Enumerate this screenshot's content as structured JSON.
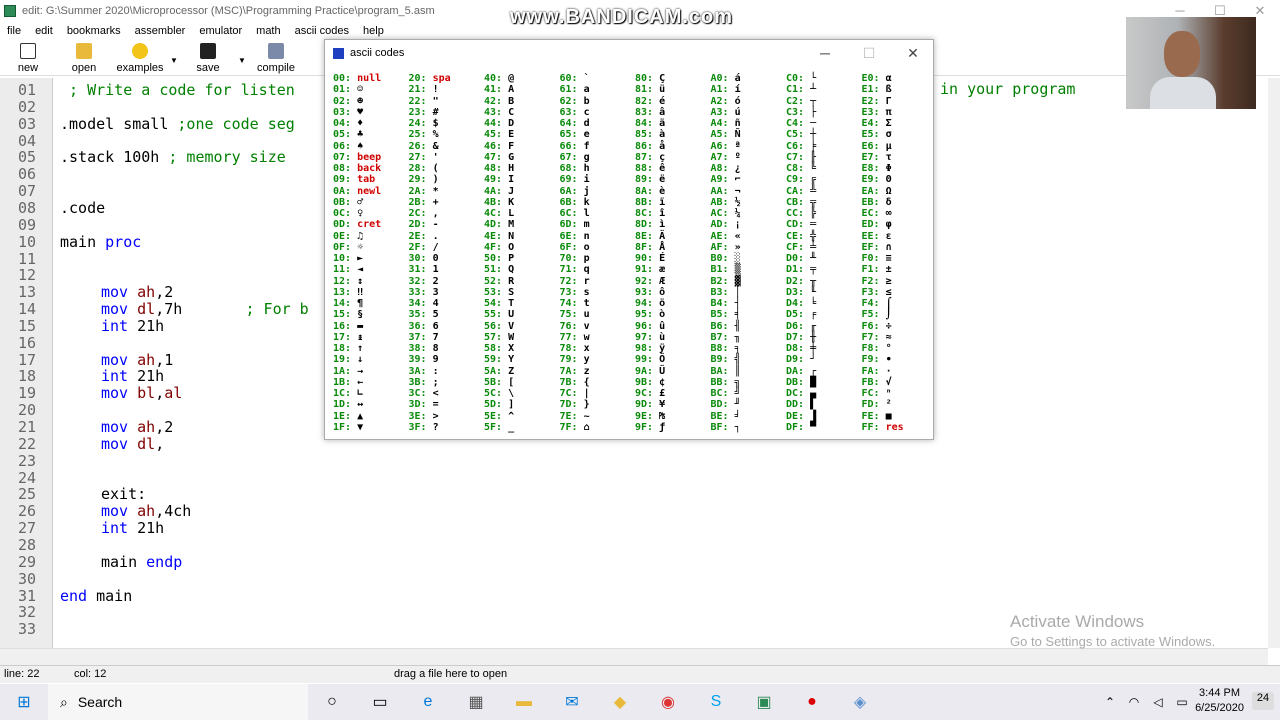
{
  "window": {
    "title": "edit: G:\\Summer 2020\\Microprocessor (MSC)\\Programming Practice\\program_5.asm"
  },
  "menu": [
    "file",
    "edit",
    "bookmarks",
    "assembler",
    "emulator",
    "math",
    "ascii codes",
    "help"
  ],
  "toolbar": [
    {
      "label": "new",
      "icon": "new-file-icon"
    },
    {
      "label": "open",
      "icon": "folder-icon"
    },
    {
      "label": "examples",
      "icon": "star-icon"
    },
    {
      "label": "save",
      "icon": "disk-icon"
    },
    {
      "label": "compile",
      "icon": "compile-icon"
    }
  ],
  "watermark": "www.BANDICAM.com",
  "line_numbers": [
    "01",
    "02",
    "03",
    "04",
    "05",
    "06",
    "07",
    "08",
    "09",
    "10",
    "11",
    "12",
    "13",
    "14",
    "15",
    "16",
    "17",
    "18",
    "19",
    "20",
    "21",
    "22",
    "23",
    "24",
    "25",
    "26",
    "27",
    "28",
    "29",
    "30",
    "31",
    "32",
    "33"
  ],
  "code": [
    {
      "line": 1,
      "indent": 0,
      "parts": [
        {
          "t": " ; Write a code for listen",
          "c": "cm"
        }
      ]
    },
    {
      "line": 3,
      "indent": 0,
      "parts": [
        {
          "t": ".model small ",
          "c": "pl"
        },
        {
          "t": ";one code seg",
          "c": "cm"
        }
      ]
    },
    {
      "line": 5,
      "indent": 0,
      "parts": [
        {
          "t": ".stack 100h ",
          "c": "pl"
        },
        {
          "t": "; memory size",
          "c": "cm"
        }
      ]
    },
    {
      "line": 8,
      "indent": 0,
      "parts": [
        {
          "t": ".code",
          "c": "pl"
        }
      ]
    },
    {
      "line": 10,
      "indent": 0,
      "parts": [
        {
          "t": "main ",
          "c": "pl"
        },
        {
          "t": "proc",
          "c": "kw"
        }
      ]
    },
    {
      "line": 13,
      "indent": 1,
      "parts": [
        {
          "t": "mov ",
          "c": "kw"
        },
        {
          "t": "ah",
          "c": "rg"
        },
        {
          "t": ",2",
          "c": "pl"
        }
      ]
    },
    {
      "line": 14,
      "indent": 1,
      "parts": [
        {
          "t": "mov ",
          "c": "kw"
        },
        {
          "t": "dl",
          "c": "rg"
        },
        {
          "t": ",7h       ",
          "c": "pl"
        },
        {
          "t": "; For b",
          "c": "cm"
        }
      ]
    },
    {
      "line": 15,
      "indent": 1,
      "parts": [
        {
          "t": "int ",
          "c": "kw"
        },
        {
          "t": "21h",
          "c": "pl"
        }
      ]
    },
    {
      "line": 17,
      "indent": 1,
      "parts": [
        {
          "t": "mov ",
          "c": "kw"
        },
        {
          "t": "ah",
          "c": "rg"
        },
        {
          "t": ",1",
          "c": "pl"
        }
      ]
    },
    {
      "line": 18,
      "indent": 1,
      "parts": [
        {
          "t": "int ",
          "c": "kw"
        },
        {
          "t": "21h",
          "c": "pl"
        }
      ]
    },
    {
      "line": 19,
      "indent": 1,
      "parts": [
        {
          "t": "mov ",
          "c": "kw"
        },
        {
          "t": "bl",
          "c": "rg"
        },
        {
          "t": ",",
          "c": "pl"
        },
        {
          "t": "al",
          "c": "rg"
        }
      ]
    },
    {
      "line": 21,
      "indent": 1,
      "parts": [
        {
          "t": "mov ",
          "c": "kw"
        },
        {
          "t": "ah",
          "c": "rg"
        },
        {
          "t": ",2",
          "c": "pl"
        }
      ]
    },
    {
      "line": 22,
      "indent": 1,
      "parts": [
        {
          "t": "mov ",
          "c": "kw"
        },
        {
          "t": "dl",
          "c": "rg"
        },
        {
          "t": ",",
          "c": "pl"
        }
      ]
    },
    {
      "line": 25,
      "indent": 1,
      "parts": [
        {
          "t": "exit:",
          "c": "pl"
        }
      ]
    },
    {
      "line": 26,
      "indent": 1,
      "parts": [
        {
          "t": "mov ",
          "c": "kw"
        },
        {
          "t": "ah",
          "c": "rg"
        },
        {
          "t": ",4ch",
          "c": "pl"
        }
      ]
    },
    {
      "line": 27,
      "indent": 1,
      "parts": [
        {
          "t": "int ",
          "c": "kw"
        },
        {
          "t": "21h",
          "c": "pl"
        }
      ]
    },
    {
      "line": 29,
      "indent": 1,
      "parts": [
        {
          "t": "main ",
          "c": "pl"
        },
        {
          "t": "endp",
          "c": "kw"
        }
      ]
    },
    {
      "line": 31,
      "indent": 0,
      "parts": [
        {
          "t": "end ",
          "c": "kw"
        },
        {
          "t": "main",
          "c": "pl"
        }
      ]
    }
  ],
  "code_right_fragment": "in your program",
  "ascii_dialog": {
    "title": "ascii codes",
    "columns": [
      [
        [
          "00",
          "null"
        ],
        [
          "01",
          "☺"
        ],
        [
          "02",
          "☻"
        ],
        [
          "03",
          "♥"
        ],
        [
          "04",
          "♦"
        ],
        [
          "05",
          "♣"
        ],
        [
          "06",
          "♠"
        ],
        [
          "07",
          "beep"
        ],
        [
          "08",
          "back"
        ],
        [
          "09",
          "tab"
        ],
        [
          "0A",
          "newl"
        ],
        [
          "0B",
          "♂"
        ],
        [
          "0C",
          "♀"
        ],
        [
          "0D",
          "cret"
        ],
        [
          "0E",
          "♫"
        ],
        [
          "0F",
          "☼"
        ],
        [
          "10",
          "►"
        ],
        [
          "11",
          "◄"
        ],
        [
          "12",
          "↕"
        ],
        [
          "13",
          "‼"
        ],
        [
          "14",
          "¶"
        ],
        [
          "15",
          "§"
        ],
        [
          "16",
          "▬"
        ],
        [
          "17",
          "↨"
        ],
        [
          "18",
          "↑"
        ],
        [
          "19",
          "↓"
        ],
        [
          "1A",
          "→"
        ],
        [
          "1B",
          "←"
        ],
        [
          "1C",
          "∟"
        ],
        [
          "1D",
          "↔"
        ],
        [
          "1E",
          "▲"
        ],
        [
          "1F",
          "▼"
        ]
      ],
      [
        [
          "20",
          "spa"
        ],
        [
          "21",
          "!"
        ],
        [
          "22",
          "\""
        ],
        [
          "23",
          "#"
        ],
        [
          "24",
          "$"
        ],
        [
          "25",
          "%"
        ],
        [
          "26",
          "&"
        ],
        [
          "27",
          "'"
        ],
        [
          "28",
          "("
        ],
        [
          "29",
          ")"
        ],
        [
          "2A",
          "*"
        ],
        [
          "2B",
          "+"
        ],
        [
          "2C",
          ","
        ],
        [
          "2D",
          "-"
        ],
        [
          "2E",
          "."
        ],
        [
          "2F",
          "/"
        ],
        [
          "30",
          "0"
        ],
        [
          "31",
          "1"
        ],
        [
          "32",
          "2"
        ],
        [
          "33",
          "3"
        ],
        [
          "34",
          "4"
        ],
        [
          "35",
          "5"
        ],
        [
          "36",
          "6"
        ],
        [
          "37",
          "7"
        ],
        [
          "38",
          "8"
        ],
        [
          "39",
          "9"
        ],
        [
          "3A",
          ":"
        ],
        [
          "3B",
          ";"
        ],
        [
          "3C",
          "<"
        ],
        [
          "3D",
          "="
        ],
        [
          "3E",
          ">"
        ],
        [
          "3F",
          "?"
        ]
      ],
      [
        [
          "40",
          "@"
        ],
        [
          "41",
          "A"
        ],
        [
          "42",
          "B"
        ],
        [
          "43",
          "C"
        ],
        [
          "44",
          "D"
        ],
        [
          "45",
          "E"
        ],
        [
          "46",
          "F"
        ],
        [
          "47",
          "G"
        ],
        [
          "48",
          "H"
        ],
        [
          "49",
          "I"
        ],
        [
          "4A",
          "J"
        ],
        [
          "4B",
          "K"
        ],
        [
          "4C",
          "L"
        ],
        [
          "4D",
          "M"
        ],
        [
          "4E",
          "N"
        ],
        [
          "4F",
          "O"
        ],
        [
          "50",
          "P"
        ],
        [
          "51",
          "Q"
        ],
        [
          "52",
          "R"
        ],
        [
          "53",
          "S"
        ],
        [
          "54",
          "T"
        ],
        [
          "55",
          "U"
        ],
        [
          "56",
          "V"
        ],
        [
          "57",
          "W"
        ],
        [
          "58",
          "X"
        ],
        [
          "59",
          "Y"
        ],
        [
          "5A",
          "Z"
        ],
        [
          "5B",
          "["
        ],
        [
          "5C",
          "\\"
        ],
        [
          "5D",
          "]"
        ],
        [
          "5E",
          "^"
        ],
        [
          "5F",
          "_"
        ]
      ],
      [
        [
          "60",
          "`"
        ],
        [
          "61",
          "a"
        ],
        [
          "62",
          "b"
        ],
        [
          "63",
          "c"
        ],
        [
          "64",
          "d"
        ],
        [
          "65",
          "e"
        ],
        [
          "66",
          "f"
        ],
        [
          "67",
          "g"
        ],
        [
          "68",
          "h"
        ],
        [
          "69",
          "i"
        ],
        [
          "6A",
          "j"
        ],
        [
          "6B",
          "k"
        ],
        [
          "6C",
          "l"
        ],
        [
          "6D",
          "m"
        ],
        [
          "6E",
          "n"
        ],
        [
          "6F",
          "o"
        ],
        [
          "70",
          "p"
        ],
        [
          "71",
          "q"
        ],
        [
          "72",
          "r"
        ],
        [
          "73",
          "s"
        ],
        [
          "74",
          "t"
        ],
        [
          "75",
          "u"
        ],
        [
          "76",
          "v"
        ],
        [
          "77",
          "w"
        ],
        [
          "78",
          "x"
        ],
        [
          "79",
          "y"
        ],
        [
          "7A",
          "z"
        ],
        [
          "7B",
          "{"
        ],
        [
          "7C",
          "|"
        ],
        [
          "7D",
          "}"
        ],
        [
          "7E",
          "~"
        ],
        [
          "7F",
          "⌂"
        ]
      ],
      [
        [
          "80",
          "Ç"
        ],
        [
          "81",
          "ü"
        ],
        [
          "82",
          "é"
        ],
        [
          "83",
          "â"
        ],
        [
          "84",
          "ä"
        ],
        [
          "85",
          "à"
        ],
        [
          "86",
          "å"
        ],
        [
          "87",
          "ç"
        ],
        [
          "88",
          "ê"
        ],
        [
          "89",
          "ë"
        ],
        [
          "8A",
          "è"
        ],
        [
          "8B",
          "ï"
        ],
        [
          "8C",
          "î"
        ],
        [
          "8D",
          "ì"
        ],
        [
          "8E",
          "Ä"
        ],
        [
          "8F",
          "Å"
        ],
        [
          "90",
          "É"
        ],
        [
          "91",
          "æ"
        ],
        [
          "92",
          "Æ"
        ],
        [
          "93",
          "ô"
        ],
        [
          "94",
          "ö"
        ],
        [
          "95",
          "ò"
        ],
        [
          "96",
          "û"
        ],
        [
          "97",
          "ù"
        ],
        [
          "98",
          "ÿ"
        ],
        [
          "99",
          "Ö"
        ],
        [
          "9A",
          "Ü"
        ],
        [
          "9B",
          "¢"
        ],
        [
          "9C",
          "£"
        ],
        [
          "9D",
          "¥"
        ],
        [
          "9E",
          "₧"
        ],
        [
          "9F",
          "ƒ"
        ]
      ],
      [
        [
          "A0",
          "á"
        ],
        [
          "A1",
          "í"
        ],
        [
          "A2",
          "ó"
        ],
        [
          "A3",
          "ú"
        ],
        [
          "A4",
          "ñ"
        ],
        [
          "A5",
          "Ñ"
        ],
        [
          "A6",
          "ª"
        ],
        [
          "A7",
          "º"
        ],
        [
          "A8",
          "¿"
        ],
        [
          "A9",
          "⌐"
        ],
        [
          "AA",
          "¬"
        ],
        [
          "AB",
          "½"
        ],
        [
          "AC",
          "¼"
        ],
        [
          "AD",
          "¡"
        ],
        [
          "AE",
          "«"
        ],
        [
          "AF",
          "»"
        ],
        [
          "B0",
          "░"
        ],
        [
          "B1",
          "▒"
        ],
        [
          "B2",
          "▓"
        ],
        [
          "B3",
          "│"
        ],
        [
          "B4",
          "┤"
        ],
        [
          "B5",
          "╡"
        ],
        [
          "B6",
          "╢"
        ],
        [
          "B7",
          "╖"
        ],
        [
          "B8",
          "╕"
        ],
        [
          "B9",
          "╣"
        ],
        [
          "BA",
          "║"
        ],
        [
          "BB",
          "╗"
        ],
        [
          "BC",
          "╝"
        ],
        [
          "BD",
          "╜"
        ],
        [
          "BE",
          "╛"
        ],
        [
          "BF",
          "┐"
        ]
      ],
      [
        [
          "C0",
          "└"
        ],
        [
          "C1",
          "┴"
        ],
        [
          "C2",
          "┬"
        ],
        [
          "C3",
          "├"
        ],
        [
          "C4",
          "─"
        ],
        [
          "C5",
          "┼"
        ],
        [
          "C6",
          "╞"
        ],
        [
          "C7",
          "╟"
        ],
        [
          "C8",
          "╚"
        ],
        [
          "C9",
          "╔"
        ],
        [
          "CA",
          "╩"
        ],
        [
          "CB",
          "╦"
        ],
        [
          "CC",
          "╠"
        ],
        [
          "CD",
          "═"
        ],
        [
          "CE",
          "╬"
        ],
        [
          "CF",
          "╧"
        ],
        [
          "D0",
          "╨"
        ],
        [
          "D1",
          "╤"
        ],
        [
          "D2",
          "╥"
        ],
        [
          "D3",
          "╙"
        ],
        [
          "D4",
          "╘"
        ],
        [
          "D5",
          "╒"
        ],
        [
          "D6",
          "╓"
        ],
        [
          "D7",
          "╫"
        ],
        [
          "D8",
          "╪"
        ],
        [
          "D9",
          "┘"
        ],
        [
          "DA",
          "┌"
        ],
        [
          "DB",
          "█"
        ],
        [
          "DC",
          "▄"
        ],
        [
          "DD",
          "▌"
        ],
        [
          "DE",
          "▐"
        ],
        [
          "DF",
          "▀"
        ]
      ],
      [
        [
          "E0",
          "α"
        ],
        [
          "E1",
          "ß"
        ],
        [
          "E2",
          "Γ"
        ],
        [
          "E3",
          "π"
        ],
        [
          "E4",
          "Σ"
        ],
        [
          "E5",
          "σ"
        ],
        [
          "E6",
          "µ"
        ],
        [
          "E7",
          "τ"
        ],
        [
          "E8",
          "Φ"
        ],
        [
          "E9",
          "Θ"
        ],
        [
          "EA",
          "Ω"
        ],
        [
          "EB",
          "δ"
        ],
        [
          "EC",
          "∞"
        ],
        [
          "ED",
          "φ"
        ],
        [
          "EE",
          "ε"
        ],
        [
          "EF",
          "∩"
        ],
        [
          "F0",
          "≡"
        ],
        [
          "F1",
          "±"
        ],
        [
          "F2",
          "≥"
        ],
        [
          "F3",
          "≤"
        ],
        [
          "F4",
          "⌠"
        ],
        [
          "F5",
          "⌡"
        ],
        [
          "F6",
          "÷"
        ],
        [
          "F7",
          "≈"
        ],
        [
          "F8",
          "°"
        ],
        [
          "F9",
          "∙"
        ],
        [
          "FA",
          "·"
        ],
        [
          "FB",
          "√"
        ],
        [
          "FC",
          "ⁿ"
        ],
        [
          "FD",
          "²"
        ],
        [
          "FE",
          "■"
        ],
        [
          "FF",
          "res"
        ]
      ]
    ],
    "red_words": [
      "null",
      "beep",
      "back",
      "tab",
      "newl",
      "cret",
      "spa",
      "res"
    ]
  },
  "status": {
    "line": "line: 22",
    "col": "col: 12",
    "hint": "drag a file here to open"
  },
  "activation": {
    "title": "Activate Windows",
    "subtitle": "Go to Settings to activate Windows."
  },
  "taskbar": {
    "search": "Search",
    "time": "3:44 PM",
    "date": "6/25/2020",
    "notifications": "24"
  }
}
